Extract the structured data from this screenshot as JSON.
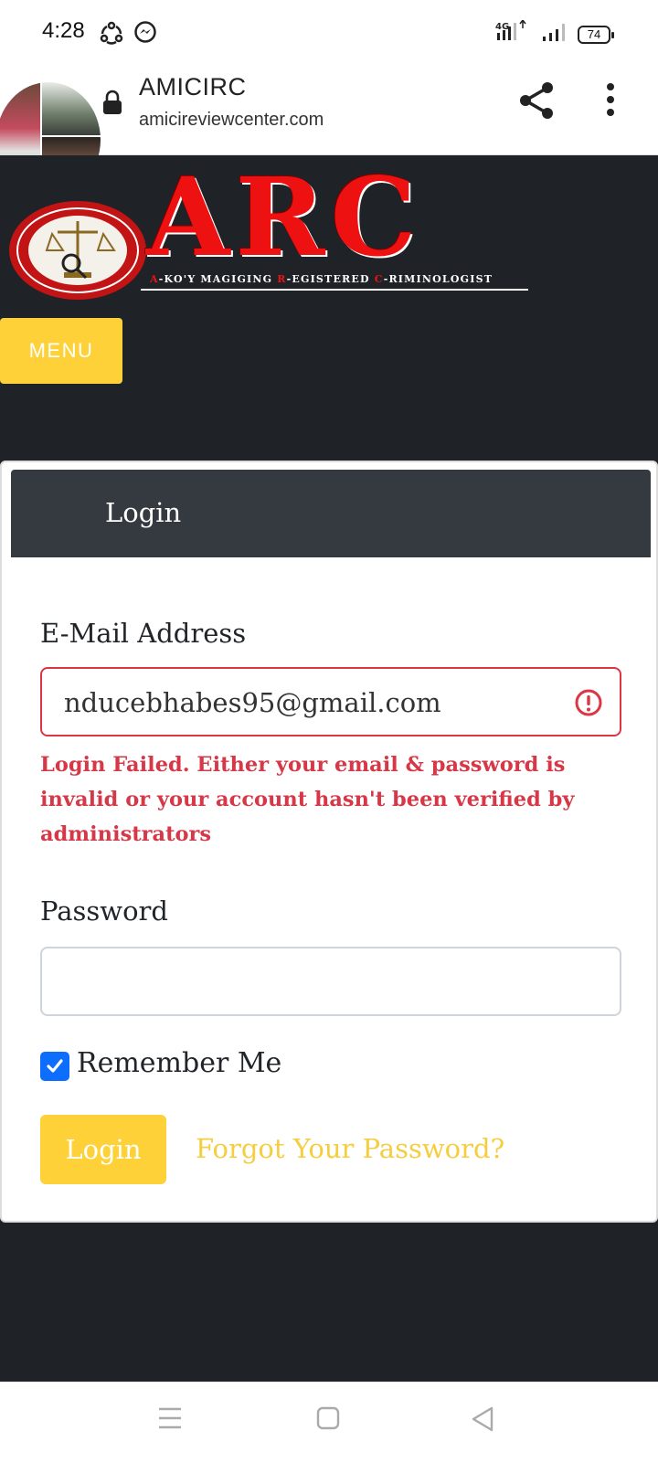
{
  "status_bar": {
    "time": "4:28",
    "network": "4G",
    "battery": "74"
  },
  "browser": {
    "site_title": "AMICIRC",
    "url": "amicireviewcenter.com"
  },
  "logo": {
    "brand": "ARC",
    "tagline_parts": [
      "A",
      "-KO'Y MAGIGING ",
      "R",
      "-EGISTERED ",
      "C",
      "-RIMINOLOGIST"
    ]
  },
  "nav": {
    "menu_label": "MENU"
  },
  "login_card": {
    "title": "Login",
    "email": {
      "label": "E-Mail Address",
      "value": "nducebhabes95@gmail.com"
    },
    "error_message": "Login Failed. Either your email & password is invalid or your account hasn't been verified by administrators",
    "password": {
      "label": "Password",
      "value": ""
    },
    "remember_me": {
      "label": "Remember Me",
      "checked": true
    },
    "login_button": "Login",
    "forgot_link": "Forgot Your Password?"
  },
  "colors": {
    "accent": "#fdd137",
    "page_bg": "#1f2226",
    "card_header": "#343a40",
    "error": "#dc3545",
    "checkbox": "#0d6efd",
    "logo_red": "#ee1111"
  }
}
